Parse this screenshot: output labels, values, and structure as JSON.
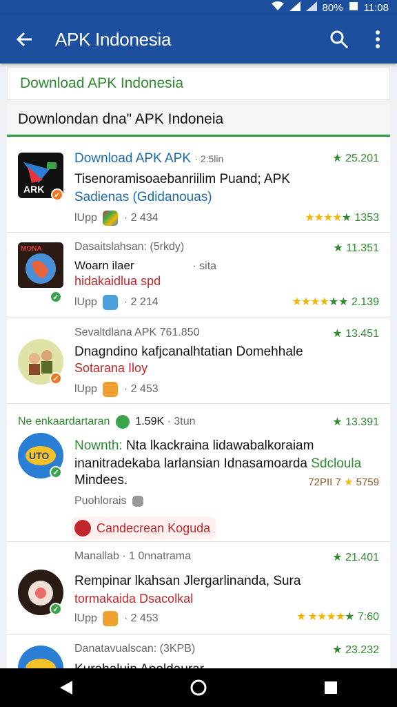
{
  "status_bar": {
    "battery": "80%",
    "time": "11:08"
  },
  "app_bar": {
    "title": "APK Indonesia"
  },
  "banner": {
    "text": "Download APK Indonesia"
  },
  "section": {
    "title": "Downlondan dna\" APK Indoneia"
  },
  "cards": [
    {
      "title": "Download APK APK",
      "time": "· 2:5lin",
      "rating": "25.201",
      "line1": "Tisenoramisoaebanriilim Puand; APK",
      "line2": "Sadienas (Gdidanouas)",
      "meta": "lUpp",
      "count": "· 2 434",
      "star_count": "1353",
      "icon_name": "apk-app-icon",
      "badge_color": "#f0781e"
    },
    {
      "title": "Dasaitslahsan: (5rkdy)",
      "rating": "11.351",
      "line1": "Woarn ilaer",
      "line1b": "· sita",
      "line2": "hidakaidlua spd",
      "meta": "lUpp",
      "count": "· 2 214",
      "star_count": "2.139",
      "icon_name": "globe-app-icon",
      "badge_color": "#3aa54a"
    },
    {
      "title": "Sevaltdlana APK 761.850",
      "rating": "13.451",
      "line1": "Dnagndino kafjcanalhtatian Domehhale",
      "line2": "Sotarana Iloy",
      "meta": "lUpp",
      "count": "· 2 453",
      "icon_name": "villagers-app-icon",
      "badge_color": "#f0781e"
    },
    {
      "header": "Ne enkaardartaran",
      "header_count": "1.59K",
      "header_time": "· 3tun",
      "rating": "13.391",
      "line1_prefix": "Nownth:",
      "line1": " Nta lkackraina lidawabalkoraiam",
      "line2": "inanitradekaba larlansian Idnasamoarda",
      "line2_green": " Sdcloula",
      "line3": "Mindees.",
      "meta": "Puohlorais",
      "side_label": "72PII 7",
      "star_count": "5759",
      "chip": "Candecrean Koguda",
      "icon_name": "sunglasses-app-icon",
      "badge_color": "#3aa54a"
    },
    {
      "title": "Manallab · 1 0nnatrama",
      "rating": "21.401",
      "line1": "Rempinar lkahsan Jlergarlinanda, Sura",
      "line2": "tormakaida Dsacolkal",
      "meta": "lUpp",
      "count": "· 2 453",
      "star_count": "7:60",
      "icon_name": "avatar-app-icon",
      "badge_color": "#3aa54a"
    },
    {
      "title": "Danatavualscan: (3KPB)",
      "rating": "23.232",
      "line1": "Kurahaluin Apoldaurar",
      "icon_name": "sunglasses-app-icon-2"
    }
  ]
}
